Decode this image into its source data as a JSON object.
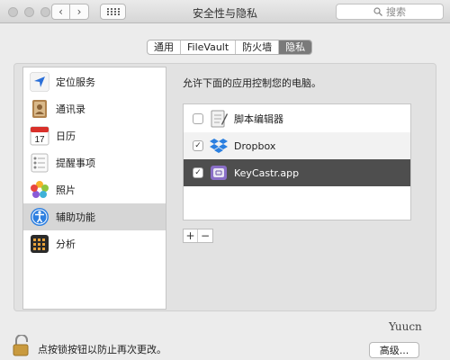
{
  "window": {
    "title": "安全性与隐私",
    "search_placeholder": "搜索",
    "back_glyph": "‹",
    "forward_glyph": "›"
  },
  "tabs": [
    {
      "label": "通用",
      "active": false
    },
    {
      "label": "FileVault",
      "active": false
    },
    {
      "label": "防火墙",
      "active": false
    },
    {
      "label": "隐私",
      "active": true
    }
  ],
  "sidebar": {
    "selected": "辅助功能",
    "items": [
      {
        "label": "定位服务",
        "icon": "location-arrow-icon"
      },
      {
        "label": "通讯录",
        "icon": "contacts-book-icon"
      },
      {
        "label": "日历",
        "icon": "calendar-icon"
      },
      {
        "label": "提醒事项",
        "icon": "reminders-list-icon"
      },
      {
        "label": "照片",
        "icon": "photos-flower-icon"
      },
      {
        "label": "辅助功能",
        "icon": "accessibility-icon"
      },
      {
        "label": "分析",
        "icon": "analytics-icon"
      }
    ]
  },
  "main": {
    "prompt": "允许下面的应用控制您的电脑。",
    "apps": [
      {
        "name": "脚本编辑器",
        "checked": false,
        "icon": "script-editor-icon"
      },
      {
        "name": "Dropbox",
        "checked": true,
        "icon": "dropbox-icon"
      },
      {
        "name": "KeyCastr.app",
        "checked": true,
        "icon": "keycastr-icon",
        "selected": true
      }
    ],
    "add_label": "+",
    "remove_label": "−"
  },
  "footer": {
    "lock_text": "点按锁按钮以防止再次更改。",
    "advanced_label": "高级..."
  },
  "watermark": "Yuucn",
  "calendar_day": "17",
  "check_glyph": "✓",
  "colors": {
    "selected_row": "#4e4e4e",
    "accessibility_blue": "#2d7fe0",
    "dropbox_blue": "#2a7fe0"
  }
}
